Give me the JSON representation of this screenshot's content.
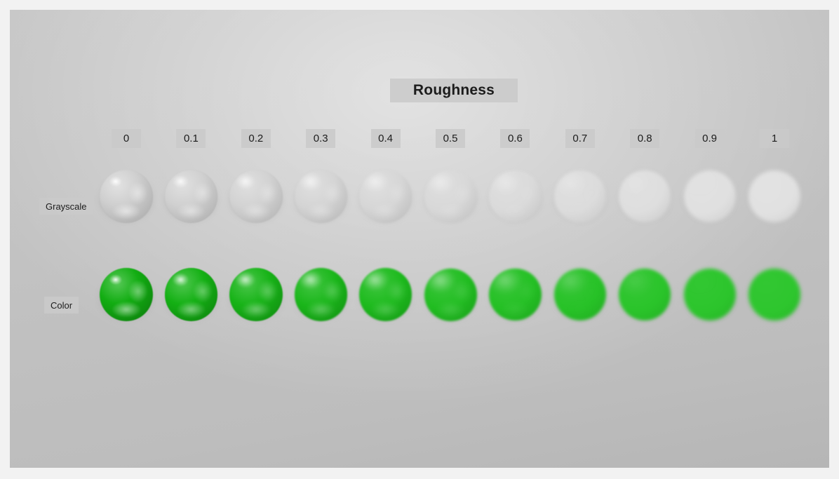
{
  "window": {
    "background_color": "#f2f2f2",
    "canvas_color": "#c2c2c2"
  },
  "header": {
    "title": "Roughness"
  },
  "columns": {
    "axis_name": "Roughness",
    "labels": [
      "0",
      "0.1",
      "0.2",
      "0.3",
      "0.4",
      "0.5",
      "0.6",
      "0.7",
      "0.8",
      "0.9",
      "1"
    ],
    "values": [
      0,
      0.1,
      0.2,
      0.3,
      0.4,
      0.5,
      0.6,
      0.7,
      0.8,
      0.9,
      1
    ]
  },
  "rows": [
    {
      "label": "Grayscale",
      "material_name": "grayscale",
      "base_color": "#d2d2d2",
      "spheres": [
        {
          "roughness": 0,
          "base": "#cfcfcf",
          "highlight": "#ffffff",
          "shadow": "#9a9a9a"
        },
        {
          "roughness": 0.1,
          "base": "#d0d0d0",
          "highlight": "#fbfbfb",
          "shadow": "#9e9e9e"
        },
        {
          "roughness": 0.2,
          "base": "#d2d2d2",
          "highlight": "#f8f8f8",
          "shadow": "#a3a3a3"
        },
        {
          "roughness": 0.3,
          "base": "#d4d4d4",
          "highlight": "#f5f5f5",
          "shadow": "#a8a8a8"
        },
        {
          "roughness": 0.4,
          "base": "#d6d6d6",
          "highlight": "#f2f2f2",
          "shadow": "#adadad"
        },
        {
          "roughness": 0.5,
          "base": "#d8d8d8",
          "highlight": "#eeeeee",
          "shadow": "#b1b1b1"
        },
        {
          "roughness": 0.6,
          "base": "#dadada",
          "highlight": "#ebebeb",
          "shadow": "#b5b5b5"
        },
        {
          "roughness": 0.7,
          "base": "#dcdcdc",
          "highlight": "#e9e9e9",
          "shadow": "#b8b8b8"
        },
        {
          "roughness": 0.8,
          "base": "#dedede",
          "highlight": "#e7e7e7",
          "shadow": "#bababa"
        },
        {
          "roughness": 0.9,
          "base": "#e0e0e0",
          "highlight": "#e6e6e6",
          "shadow": "#bcbcbc"
        },
        {
          "roughness": 1,
          "base": "#e1e1e1",
          "highlight": "#e5e5e5",
          "shadow": "#bebebe"
        }
      ]
    },
    {
      "label": "Color",
      "material_name": "color",
      "base_color": "#19b819",
      "spheres": [
        {
          "roughness": 0,
          "base": "#12ad12",
          "highlight": "#bdf0bd",
          "shadow": "#0a6a0a"
        },
        {
          "roughness": 0.1,
          "base": "#14b014",
          "highlight": "#b4eeb4",
          "shadow": "#0b700b"
        },
        {
          "roughness": 0.2,
          "base": "#17b317",
          "highlight": "#a8eaa8",
          "shadow": "#0d780d"
        },
        {
          "roughness": 0.3,
          "base": "#1ab61a",
          "highlight": "#99e699",
          "shadow": "#0f7f0f"
        },
        {
          "roughness": 0.4,
          "base": "#1dba1d",
          "highlight": "#8ae28a",
          "shadow": "#128712"
        },
        {
          "roughness": 0.5,
          "base": "#21bd21",
          "highlight": "#7cdd7c",
          "shadow": "#158e15"
        },
        {
          "roughness": 0.6,
          "base": "#24c024",
          "highlight": "#6fd96f",
          "shadow": "#189518"
        },
        {
          "roughness": 0.7,
          "base": "#27c227",
          "highlight": "#63d563",
          "shadow": "#1b9b1b"
        },
        {
          "roughness": 0.8,
          "base": "#2ac42a",
          "highlight": "#57d157",
          "shadow": "#1ea01e"
        },
        {
          "roughness": 0.9,
          "base": "#2cc52c",
          "highlight": "#4ece4e",
          "shadow": "#20a420"
        },
        {
          "roughness": 1,
          "base": "#2ec62e",
          "highlight": "#46cb46",
          "shadow": "#22a722"
        }
      ]
    }
  ]
}
